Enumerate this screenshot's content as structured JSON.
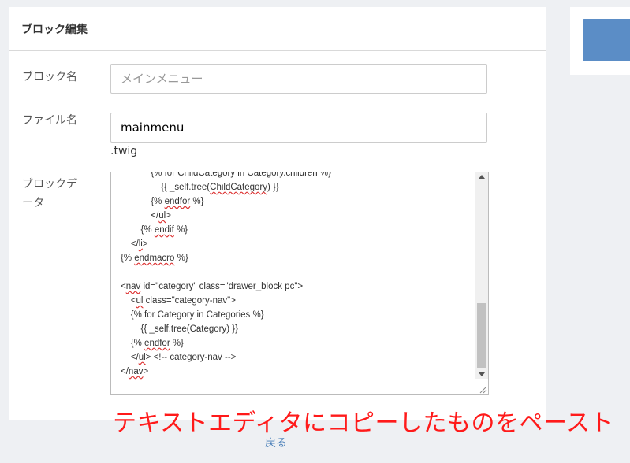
{
  "panel": {
    "title": "ブロック編集",
    "block_name": {
      "label": "ブロック名",
      "placeholder": "メインメニュー",
      "value": ""
    },
    "file_name": {
      "label": "ファイル名",
      "value": "mainmenu",
      "suffix": ".twig"
    },
    "block_data": {
      "label_line1": "ブロックデ",
      "label_line2": "ータ"
    }
  },
  "editor": {
    "lines": [
      {
        "indent": "            ",
        "text": "{% for ChildCategory in Category.children %}"
      },
      {
        "indent": "                ",
        "pre": "{{ _self.tree(",
        "spell": "ChildCategory",
        "post": ") }}"
      },
      {
        "indent": "            ",
        "pre": "{% ",
        "spell": "endfor",
        "post": " %}"
      },
      {
        "indent": "            ",
        "pre": "</",
        "spell": "ul",
        "post": ">"
      },
      {
        "indent": "        ",
        "pre": "{% ",
        "spell": "endif",
        "post": " %}"
      },
      {
        "indent": "    ",
        "pre": "</",
        "spell": "li",
        "post": ">"
      },
      {
        "indent": "",
        "pre": "{% ",
        "spell": "endmacro",
        "post": " %}"
      },
      {
        "indent": "",
        "pre": "",
        "spell": "",
        "post": ""
      },
      {
        "indent": "",
        "pre": "<",
        "spell": "nav",
        "post": " id=\"category\" class=\"drawer_block pc\">"
      },
      {
        "indent": "    ",
        "pre": "<",
        "spell": "ul",
        "post": " class=\"category-nav\">"
      },
      {
        "indent": "    ",
        "pre": "{% for Category in Categories %}",
        "spell": "",
        "post": ""
      },
      {
        "indent": "        ",
        "pre": "{{ _self.tree(Category) }}",
        "spell": "",
        "post": ""
      },
      {
        "indent": "    ",
        "pre": "{% ",
        "spell": "endfor",
        "post": " %}"
      },
      {
        "indent": "    ",
        "pre": "</",
        "spell": "ul",
        "post": "> <!-- category-nav -->"
      },
      {
        "indent": "",
        "pre": "</",
        "spell": "nav",
        "post": ">"
      }
    ]
  },
  "annotation": "テキストエディタにコピーしたものをペースト",
  "footer": {
    "back_label": "戻る"
  },
  "colors": {
    "accent_button": "#5b8dc6",
    "annotation_red": "#ff1a1a",
    "link_blue": "#4a7fb8"
  }
}
